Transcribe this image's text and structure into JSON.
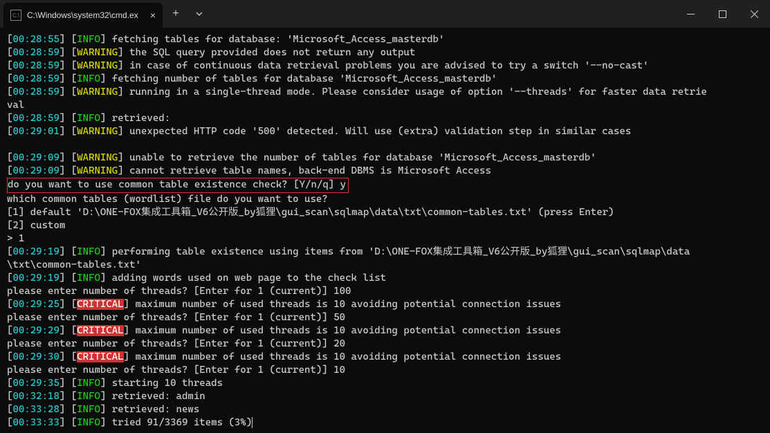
{
  "window": {
    "tab_title": "C:\\Windows\\system32\\cmd.ex"
  },
  "lines": [
    {
      "ts": "00:28:55",
      "tag": "INFO",
      "msg": "fetching tables for database: 'Microsoft_Access_masterdb'"
    },
    {
      "ts": "00:28:59",
      "tag": "WARNING",
      "msg": "the SQL query provided does not return any output"
    },
    {
      "ts": "00:28:59",
      "tag": "WARNING",
      "msg": "in case of continuous data retrieval problems you are advised to try a switch '--no-cast'"
    },
    {
      "ts": "00:28:59",
      "tag": "INFO",
      "msg": "fetching number of tables for database 'Microsoft_Access_masterdb'"
    },
    {
      "ts": "00:28:59",
      "tag": "WARNING",
      "msg": "running in a single-thread mode. Please consider usage of option '--threads' for faster data retrie"
    },
    {
      "plain": "val"
    },
    {
      "ts": "00:28:59",
      "tag": "INFO",
      "msg": "retrieved:"
    },
    {
      "ts": "00:29:01",
      "tag": "WARNING",
      "msg": "unexpected HTTP code '500' detected. Will use (extra) validation step in similar cases"
    },
    {
      "plain": ""
    },
    {
      "ts": "00:29:09",
      "tag": "WARNING",
      "msg": "unable to retrieve the number of tables for database 'Microsoft_Access_masterdb'"
    },
    {
      "ts": "00:29:09",
      "tag": "WARNING",
      "msg": "cannot retrieve table names, back-end DBMS is Microsoft Access"
    },
    {
      "boxed_prompt": "do you want to use common table existence check? [Y/n/q] ",
      "boxed_answer": "y"
    },
    {
      "plain": "which common tables (wordlist) file do you want to use?"
    },
    {
      "plain": "[1] default 'D:\\ONE-FOX集成工具箱_V6公开版_by狐狸\\gui_scan\\sqlmap\\data\\txt\\common-tables.txt' (press Enter)"
    },
    {
      "plain": "[2] custom"
    },
    {
      "plain": "> 1"
    },
    {
      "ts": "00:29:19",
      "tag": "INFO",
      "msg": "performing table existence using items from 'D:\\ONE-FOX集成工具箱_V6公开版_by狐狸\\gui_scan\\sqlmap\\data"
    },
    {
      "plain": "\\txt\\common-tables.txt'"
    },
    {
      "ts": "00:29:19",
      "tag": "INFO",
      "msg": "adding words used on web page to the check list"
    },
    {
      "plain": "please enter number of threads? [Enter for 1 (current)] 100"
    },
    {
      "ts": "00:29:25",
      "tag": "CRITICAL",
      "msg": "maximum number of used threads is 10 avoiding potential connection issues"
    },
    {
      "plain": "please enter number of threads? [Enter for 1 (current)] 50"
    },
    {
      "ts": "00:29:29",
      "tag": "CRITICAL",
      "msg": "maximum number of used threads is 10 avoiding potential connection issues"
    },
    {
      "plain": "please enter number of threads? [Enter for 1 (current)] 20"
    },
    {
      "ts": "00:29:30",
      "tag": "CRITICAL",
      "msg": "maximum number of used threads is 10 avoiding potential connection issues"
    },
    {
      "plain": "please enter number of threads? [Enter for 1 (current)] 10"
    },
    {
      "ts": "00:29:35",
      "tag": "INFO",
      "msg": "starting 10 threads"
    },
    {
      "ts": "00:32:18",
      "tag": "INFO",
      "msg": "retrieved: admin"
    },
    {
      "ts": "00:33:28",
      "tag": "INFO",
      "msg": "retrieved: news"
    },
    {
      "ts": "00:33:33",
      "tag": "INFO",
      "msg": "tried 91/3369 items (3%)",
      "cursor": true
    }
  ]
}
